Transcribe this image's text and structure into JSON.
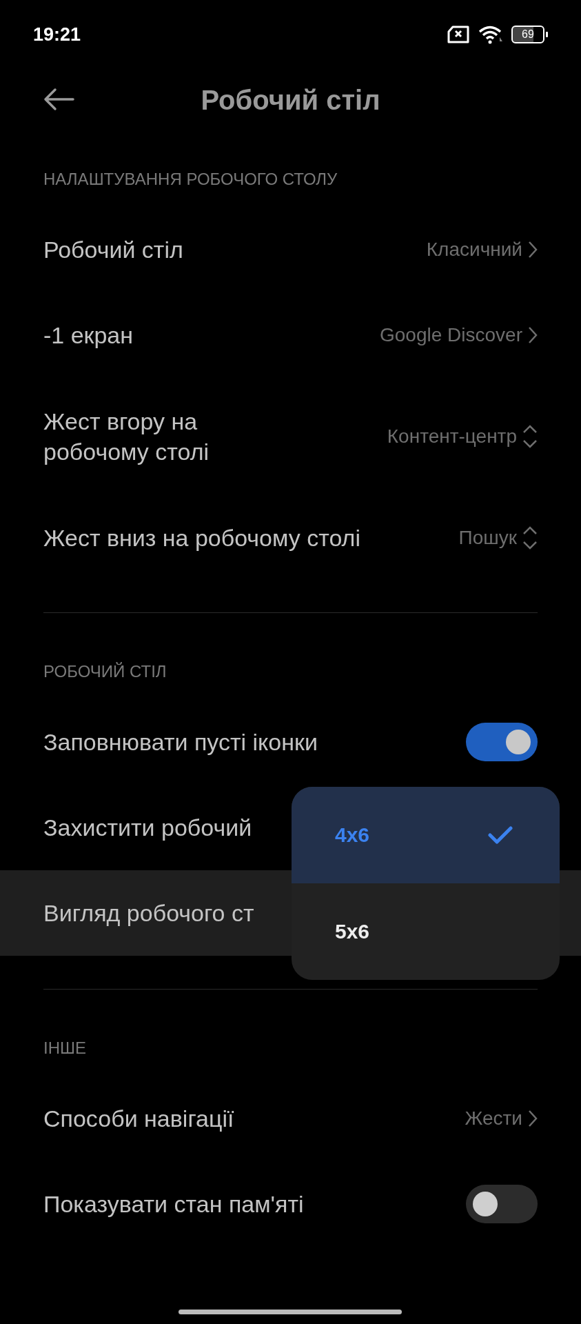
{
  "status_bar": {
    "time": "19:21",
    "battery": "69"
  },
  "header": {
    "title": "Робочий стіл"
  },
  "sections": [
    {
      "title": "НАЛАШТУВАННЯ РОБОЧОГО СТОЛУ",
      "rows": [
        {
          "kind": "link",
          "label": "Робочий стіл",
          "value": "Класичний",
          "highlighted": false
        },
        {
          "kind": "link",
          "label": "-1 екран",
          "value": "Google Discover",
          "highlighted": false
        },
        {
          "kind": "select",
          "label": "Жест вгору на робочому столі",
          "value": "Контент-центр",
          "highlighted": false
        },
        {
          "kind": "select",
          "label": "Жест вниз на робочому столі",
          "value": "Пошук",
          "highlighted": false
        }
      ]
    },
    {
      "title": "РОБОЧИЙ СТІЛ",
      "rows": [
        {
          "kind": "toggle",
          "label": "Заповнювати пусті іконки",
          "on": true,
          "highlighted": false
        },
        {
          "kind": "covered",
          "label": "Захистити робочий",
          "highlighted": false
        },
        {
          "kind": "covered",
          "label": "Вигляд робочого ст",
          "highlighted": true
        }
      ]
    },
    {
      "title": "ІНШЕ",
      "rows": [
        {
          "kind": "link",
          "label": "Способи навігації",
          "value": "Жести",
          "highlighted": false
        },
        {
          "kind": "toggle",
          "label": "Показувати стан пам'яті",
          "on": false,
          "highlighted": false
        }
      ]
    }
  ],
  "menu": {
    "options": [
      {
        "label": "4x6",
        "selected": true
      },
      {
        "label": "5x6",
        "selected": false
      }
    ]
  }
}
